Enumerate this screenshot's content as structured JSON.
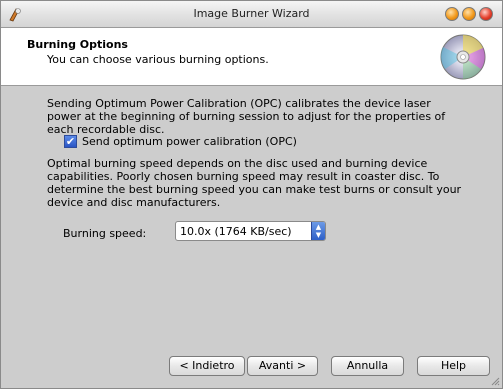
{
  "window": {
    "title": "Image Burner Wizard"
  },
  "header": {
    "title": "Burning Options",
    "subtitle": "You can choose various burning options.",
    "icon": "cd-disc-icon"
  },
  "content": {
    "opc_paragraph": "Sending Optimum Power Calibration (OPC) calibrates the device laser power at the beginning of burning session to adjust for the properties of each recordable disc.",
    "opc_checkbox": {
      "label": "Send optimum power calibration (OPC)",
      "checked": true
    },
    "speed_paragraph": "Optimal burning speed depends on the disc used and burning device capabilities. Poorly chosen burning speed may result in coaster disc. To determine the best burning speed you can make test burns or consult your device and disc manufacturers.",
    "speed": {
      "label": "Burning speed:",
      "value": "10.0x (1764 KB/sec)"
    }
  },
  "buttons": {
    "back": "< Indietro",
    "next": "Avanti >",
    "cancel": "Annulla",
    "help": "Help"
  },
  "colors": {
    "accent": "#2a55c4",
    "content_bg": "#cdcdcd"
  }
}
